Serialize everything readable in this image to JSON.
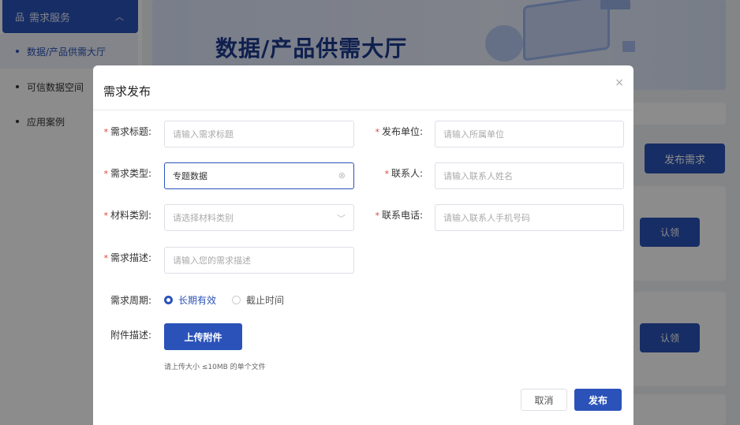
{
  "sidebar": {
    "header": "需求服务",
    "items": [
      {
        "label": "数据/产品供需大厅"
      },
      {
        "label": "可信数据空间"
      },
      {
        "label": "应用案例"
      }
    ]
  },
  "banner": {
    "title": "数据/产品供需大厅"
  },
  "background": {
    "publish_button": "发布需求",
    "claim_button_1": "认领",
    "claim_button_2": "认领"
  },
  "modal": {
    "title": "需求发布",
    "close": "×",
    "fields": {
      "title": {
        "label": "需求标题:",
        "placeholder": "请输入需求标题"
      },
      "unit": {
        "label": "发布单位:",
        "placeholder": "请输入所属单位"
      },
      "type": {
        "label": "需求类型:",
        "value": "专题数据"
      },
      "contact": {
        "label": "联系人:",
        "placeholder": "请输入联系人姓名"
      },
      "material": {
        "label": "材料类别:",
        "placeholder": "请选择材料类别"
      },
      "phone": {
        "label": "联系电话:",
        "placeholder": "请输入联系人手机号码"
      },
      "desc": {
        "label": "需求描述:",
        "placeholder": "请输入您的需求描述"
      }
    },
    "period": {
      "label": "需求周期:",
      "options": [
        "长期有效",
        "截止时间"
      ],
      "selected": "长期有效"
    },
    "attachment": {
      "label": "附件描述:",
      "button": "上传附件",
      "hint": "请上传大小 ≤10MB 的单个文件"
    },
    "cancel": "取消",
    "submit": "发布"
  },
  "colors": {
    "primary": "#2a52b8",
    "required": "#e2413b"
  }
}
